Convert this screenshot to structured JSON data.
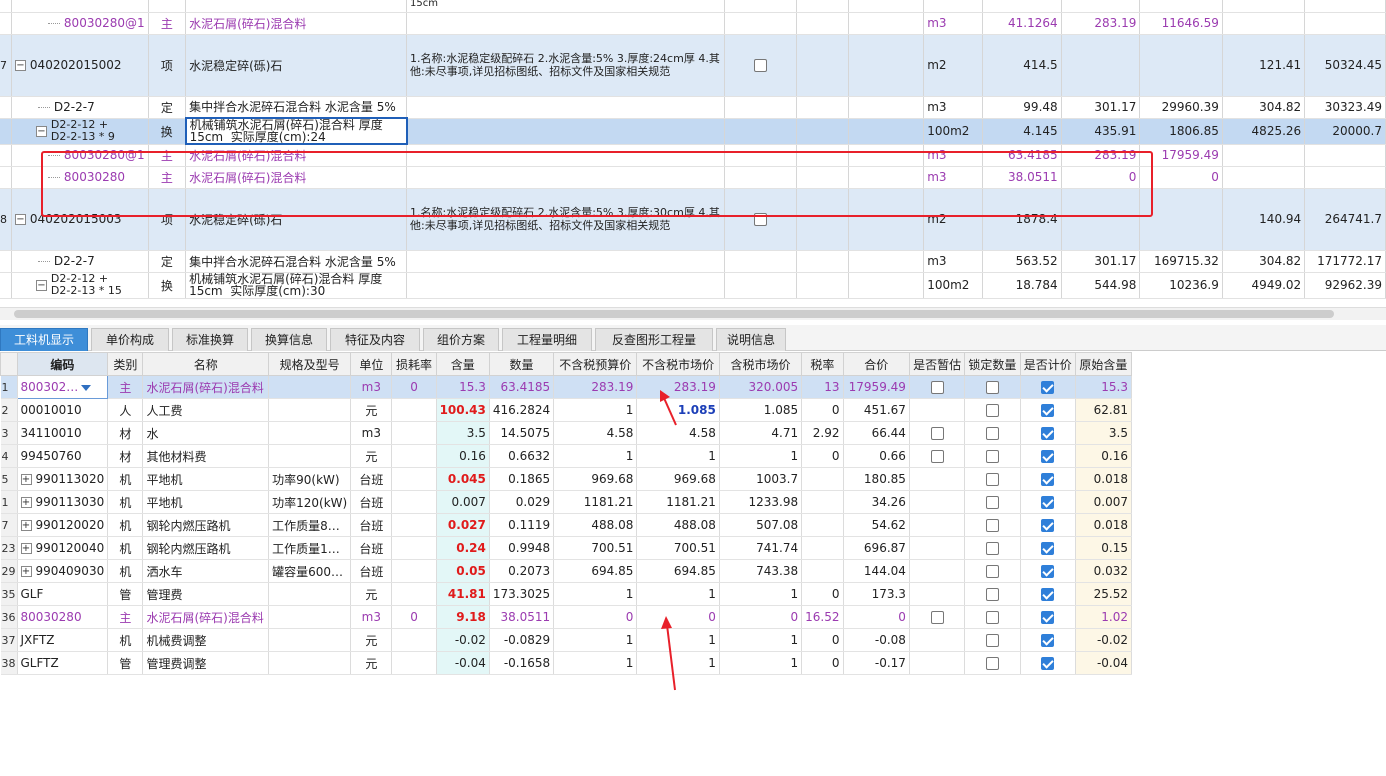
{
  "top_rows": [
    {
      "type": "partial",
      "code": "",
      "kind": "",
      "name": "",
      "desc": "15cm",
      "unit": "",
      "qty": "",
      "p1": "",
      "p2": "",
      "p3": "",
      "p4": ""
    },
    {
      "type": "sub",
      "code": "80030280@1",
      "kind": "主",
      "name": "水泥石屑(碎石)混合料",
      "desc": "",
      "unit": "m3",
      "qty": "41.1264",
      "p1": "283.19",
      "p2": "11646.59",
      "p3": "",
      "p4": ""
    },
    {
      "type": "item",
      "rownum": "7",
      "code": "040202015002",
      "kind": "项",
      "name": "水泥稳定碎(砾)石",
      "desc": "1.名称:水泥稳定级配碎石\n2.水泥含量:5%\n3.厚度:24cm厚\n4.其他:未尽事项,详见招标图纸、招标文件及国家相关规范",
      "unit": "m2",
      "qty": "414.5",
      "p1": "",
      "p2": "",
      "p3": "121.41",
      "p4": "50324.45"
    },
    {
      "type": "quota",
      "code": "D2-2-7",
      "kind": "定",
      "name": "集中拌合水泥碎石混合料 水泥含量 5%",
      "desc": "",
      "unit": "m3",
      "qty": "99.48",
      "p1": "301.17",
      "p2": "29960.39",
      "p3": "304.82",
      "p4": "30323.49"
    },
    {
      "type": "selected",
      "code": "D2-2-12 +\nD2-2-13 * 9",
      "kind": "换",
      "name": "机械铺筑水泥石屑(碎石)混合料 厚度\n15cm  实际厚度(cm):24",
      "desc": "",
      "unit": "100m2",
      "qty": "4.145",
      "p1": "435.91",
      "p2": "1806.85",
      "p3": "4825.26",
      "p4": "20000.7"
    },
    {
      "type": "sub",
      "code": "80030280@1",
      "kind": "主",
      "name": "水泥石屑(碎石)混合料",
      "desc": "",
      "unit": "m3",
      "qty": "63.4185",
      "p1": "283.19",
      "p2": "17959.49",
      "p3": "",
      "p4": ""
    },
    {
      "type": "sub",
      "code": "80030280",
      "kind": "主",
      "name": "水泥石屑(碎石)混合料",
      "desc": "",
      "unit": "m3",
      "qty": "38.0511",
      "p1": "0",
      "p2": "0",
      "p3": "",
      "p4": ""
    },
    {
      "type": "item",
      "rownum": "8",
      "code": "040202015003",
      "kind": "项",
      "name": "水泥稳定碎(砾)石",
      "desc": "1.名称:水泥稳定级配碎石\n2.水泥含量:5%\n3.厚度:30cm厚\n4.其他:未尽事项,详见招标图纸、招标文件及国家相关规范",
      "unit": "m2",
      "qty": "1878.4",
      "p1": "",
      "p2": "",
      "p3": "140.94",
      "p4": "264741.7"
    },
    {
      "type": "quota",
      "code": "D2-2-7",
      "kind": "定",
      "name": "集中拌合水泥碎石混合料 水泥含量 5%",
      "desc": "",
      "unit": "m3",
      "qty": "563.52",
      "p1": "301.17",
      "p2": "169715.32",
      "p3": "304.82",
      "p4": "171772.17"
    },
    {
      "type": "quota2",
      "code": "D2-2-12 +\nD2-2-13 * 15",
      "kind": "换",
      "name": "机械铺筑水泥石屑(碎石)混合料 厚度\n15cm  实际厚度(cm):30",
      "desc": "",
      "unit": "100m2",
      "qty": "18.784",
      "p1": "544.98",
      "p2": "10236.9",
      "p3": "4949.02",
      "p4": "92962.39"
    }
  ],
  "tabs": [
    "工料机显示",
    "单价构成",
    "标准换算",
    "换算信息",
    "特征及内容",
    "组价方案",
    "工程量明细",
    "反查图形工程量",
    "说明信息"
  ],
  "columns": [
    "编码",
    "类别",
    "名称",
    "规格及型号",
    "单位",
    "损耗率",
    "含量",
    "数量",
    "不含税预算价",
    "不含税市场价",
    "含税市场价",
    "税率",
    "合价",
    "是否暂估",
    "锁定数量",
    "是否计价",
    "原始含量"
  ],
  "rows": [
    {
      "rn": "1",
      "code": "800302…",
      "kind": "主",
      "name": "水泥石屑(碎石)混合料",
      "spec": "",
      "unit": "m3",
      "loss": "0",
      "content": "15.3",
      "qty": "63.4185",
      "budget": "283.19",
      "market": "283.19",
      "taxmarket": "320.005",
      "tax": "13",
      "total": "17959.49",
      "est": "off",
      "lock": "off",
      "price": "on",
      "orig": "15.3",
      "purple": true,
      "selected": true,
      "contentStyle": "",
      "marketStyle": "",
      "expand": false
    },
    {
      "rn": "2",
      "code": "00010010",
      "kind": "人",
      "name": "人工费",
      "spec": "",
      "unit": "元",
      "loss": "",
      "content": "100.43",
      "qty": "416.2824",
      "budget": "1",
      "market": "1.085",
      "taxmarket": "1.085",
      "tax": "0",
      "total": "451.67",
      "est": "",
      "lock": "off",
      "price": "on",
      "orig": "62.81",
      "contentStyle": "red",
      "marketStyle": "bluebold",
      "expand": false
    },
    {
      "rn": "3",
      "code": "34110010",
      "kind": "材",
      "name": "水",
      "spec": "",
      "unit": "m3",
      "loss": "",
      "content": "3.5",
      "qty": "14.5075",
      "budget": "4.58",
      "market": "4.58",
      "taxmarket": "4.71",
      "tax": "2.92",
      "total": "66.44",
      "est": "off",
      "lock": "off",
      "price": "on",
      "orig": "3.5",
      "contentStyle": "",
      "marketStyle": "",
      "expand": false
    },
    {
      "rn": "4",
      "code": "99450760",
      "kind": "材",
      "name": "其他材料费",
      "spec": "",
      "unit": "元",
      "loss": "",
      "content": "0.16",
      "qty": "0.6632",
      "budget": "1",
      "market": "1",
      "taxmarket": "1",
      "tax": "0",
      "total": "0.66",
      "est": "off",
      "lock": "off",
      "price": "on",
      "orig": "0.16",
      "contentStyle": "",
      "marketStyle": "",
      "expand": false
    },
    {
      "rn": "5",
      "code": "990113020",
      "kind": "机",
      "name": "平地机",
      "spec": "功率90(kW)",
      "unit": "台班",
      "loss": "",
      "content": "0.045",
      "qty": "0.1865",
      "budget": "969.68",
      "market": "969.68",
      "taxmarket": "1003.7",
      "tax": "",
      "total": "180.85",
      "est": "",
      "lock": "off",
      "price": "on",
      "orig": "0.018",
      "contentStyle": "red",
      "marketStyle": "",
      "expand": true
    },
    {
      "rn": "1",
      "code": "990113030",
      "kind": "机",
      "name": "平地机",
      "spec": "功率120(kW)",
      "unit": "台班",
      "loss": "",
      "content": "0.007",
      "qty": "0.029",
      "budget": "1181.21",
      "market": "1181.21",
      "taxmarket": "1233.98",
      "tax": "",
      "total": "34.26",
      "est": "",
      "lock": "off",
      "price": "on",
      "orig": "0.007",
      "contentStyle": "",
      "marketStyle": "",
      "expand": true
    },
    {
      "rn": "7",
      "code": "990120020",
      "kind": "机",
      "name": "钢轮内燃压路机",
      "spec": "工作质量8…",
      "unit": "台班",
      "loss": "",
      "content": "0.027",
      "qty": "0.1119",
      "budget": "488.08",
      "market": "488.08",
      "taxmarket": "507.08",
      "tax": "",
      "total": "54.62",
      "est": "",
      "lock": "off",
      "price": "on",
      "orig": "0.018",
      "contentStyle": "red",
      "marketStyle": "",
      "expand": true
    },
    {
      "rn": "23",
      "code": "990120040",
      "kind": "机",
      "name": "钢轮内燃压路机",
      "spec": "工作质量1…",
      "unit": "台班",
      "loss": "",
      "content": "0.24",
      "qty": "0.9948",
      "budget": "700.51",
      "market": "700.51",
      "taxmarket": "741.74",
      "tax": "",
      "total": "696.87",
      "est": "",
      "lock": "off",
      "price": "on",
      "orig": "0.15",
      "contentStyle": "red",
      "marketStyle": "",
      "expand": true
    },
    {
      "rn": "29",
      "code": "990409030",
      "kind": "机",
      "name": "洒水车",
      "spec": "罐容量600…",
      "unit": "台班",
      "loss": "",
      "content": "0.05",
      "qty": "0.2073",
      "budget": "694.85",
      "market": "694.85",
      "taxmarket": "743.38",
      "tax": "",
      "total": "144.04",
      "est": "",
      "lock": "off",
      "price": "on",
      "orig": "0.032",
      "contentStyle": "red",
      "marketStyle": "",
      "expand": true
    },
    {
      "rn": "35",
      "code": "GLF",
      "kind": "管",
      "name": "管理费",
      "spec": "",
      "unit": "元",
      "loss": "",
      "content": "41.81",
      "qty": "173.3025",
      "budget": "1",
      "market": "1",
      "taxmarket": "1",
      "tax": "0",
      "total": "173.3",
      "est": "",
      "lock": "off",
      "price": "on",
      "orig": "25.52",
      "contentStyle": "red",
      "marketStyle": "",
      "expand": false
    },
    {
      "rn": "36",
      "code": "80030280",
      "kind": "主",
      "name": "水泥石屑(碎石)混合料",
      "spec": "",
      "unit": "m3",
      "loss": "0",
      "content": "9.18",
      "qty": "38.0511",
      "budget": "0",
      "market": "0",
      "taxmarket": "0",
      "tax": "16.52",
      "total": "0",
      "est": "off",
      "lock": "off",
      "price": "on",
      "orig": "1.02",
      "purple": true,
      "contentStyle": "red",
      "marketStyle": "",
      "expand": false
    },
    {
      "rn": "37",
      "code": "JXFTZ",
      "kind": "机",
      "name": "机械费调整",
      "spec": "",
      "unit": "元",
      "loss": "",
      "content": "-0.02",
      "qty": "-0.0829",
      "budget": "1",
      "market": "1",
      "taxmarket": "1",
      "tax": "0",
      "total": "-0.08",
      "est": "",
      "lock": "off",
      "price": "on",
      "orig": "-0.02",
      "contentStyle": "",
      "marketStyle": "",
      "expand": false
    },
    {
      "rn": "38",
      "code": "GLFTZ",
      "kind": "管",
      "name": "管理费调整",
      "spec": "",
      "unit": "元",
      "loss": "",
      "content": "-0.04",
      "qty": "-0.1658",
      "budget": "1",
      "market": "1",
      "taxmarket": "1",
      "tax": "0",
      "total": "-0.17",
      "est": "",
      "lock": "off",
      "price": "on",
      "orig": "-0.04",
      "contentStyle": "",
      "marketStyle": "",
      "expand": false
    }
  ],
  "colors": {
    "accent": "#3e8ed8",
    "highlight_box": "#e8202a",
    "purple_text": "#9b3bb0",
    "red_text": "#e01b1b"
  }
}
